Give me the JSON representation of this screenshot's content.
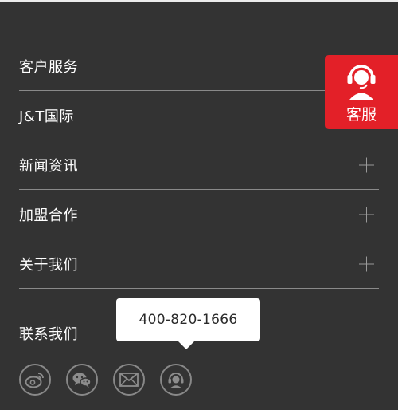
{
  "menu": {
    "items": [
      {
        "label": "客户服务",
        "expandable": false
      },
      {
        "label": "J&T国际",
        "expandable": false
      },
      {
        "label": "新闻资讯",
        "expandable": true
      },
      {
        "label": "加盟合作",
        "expandable": true
      },
      {
        "label": "关于我们",
        "expandable": true
      }
    ]
  },
  "contact": {
    "title": "联系我们",
    "phone": "400-820-1666",
    "icons": [
      "weibo-icon",
      "wechat-icon",
      "mail-icon",
      "customer-service-icon"
    ]
  },
  "floating_service": {
    "label": "客服",
    "color": "#e32028"
  },
  "colors": {
    "background": "#333333",
    "divider": "#8a8a8a",
    "accent": "#e32028"
  }
}
